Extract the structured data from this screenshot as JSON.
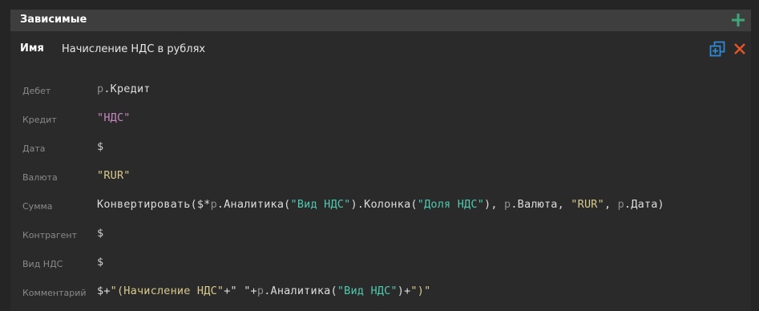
{
  "header": {
    "title": "Зависимые"
  },
  "record": {
    "name_label": "Имя",
    "name_value": "Начисление НДС в рублях"
  },
  "fields": [
    {
      "label": "Дебет",
      "tokens": [
        {
          "t": "р",
          "c": "t-var"
        },
        {
          "t": ".Кредит",
          "c": ""
        }
      ]
    },
    {
      "label": "Кредит",
      "tokens": [
        {
          "t": "\"НДС\"",
          "c": "t-str2"
        }
      ]
    },
    {
      "label": "Дата",
      "tokens": [
        {
          "t": "$",
          "c": "t-dollar"
        }
      ]
    },
    {
      "label": "Валюта",
      "tokens": [
        {
          "t": "\"RUR\"",
          "c": "t-str"
        }
      ]
    },
    {
      "label": "Сумма",
      "tokens": [
        {
          "t": "Конвертировать($*",
          "c": ""
        },
        {
          "t": "р",
          "c": "t-var"
        },
        {
          "t": ".Аналитика(",
          "c": ""
        },
        {
          "t": "\"Вид НДС\"",
          "c": "t-lit"
        },
        {
          "t": ").Колонка(",
          "c": ""
        },
        {
          "t": "\"Доля НДС\"",
          "c": "t-lit"
        },
        {
          "t": "), ",
          "c": ""
        },
        {
          "t": "р",
          "c": "t-var"
        },
        {
          "t": ".Валюта, ",
          "c": ""
        },
        {
          "t": "\"RUR\"",
          "c": "t-str"
        },
        {
          "t": ", ",
          "c": ""
        },
        {
          "t": "р",
          "c": "t-var"
        },
        {
          "t": ".Дата)",
          "c": ""
        }
      ]
    },
    {
      "label": "Контрагент",
      "tokens": [
        {
          "t": "$",
          "c": "t-dollar"
        }
      ]
    },
    {
      "label": "Вид НДС",
      "tokens": [
        {
          "t": "$",
          "c": "t-dollar"
        }
      ]
    },
    {
      "label": "Комментарий",
      "tokens": [
        {
          "t": "$+",
          "c": ""
        },
        {
          "t": "\"(Начисление НДС\"",
          "c": "t-str"
        },
        {
          "t": "+\" \"+",
          "c": ""
        },
        {
          "t": "р",
          "c": "t-var"
        },
        {
          "t": ".Аналитика(",
          "c": ""
        },
        {
          "t": "\"Вид НДС\"",
          "c": "t-lit"
        },
        {
          "t": ")+",
          "c": ""
        },
        {
          "t": "\")\"",
          "c": "t-str"
        }
      ]
    }
  ],
  "colors": {
    "accent_add": "#3fa67a",
    "accent_copy": "#2e8ad6",
    "accent_close": "#e65526"
  }
}
